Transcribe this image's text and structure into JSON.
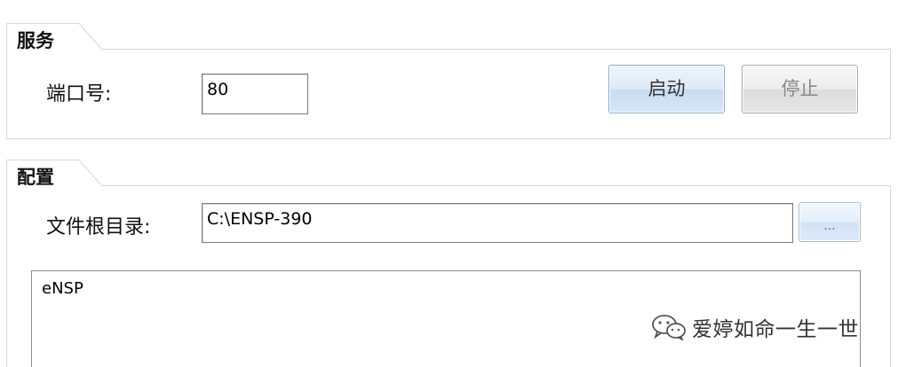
{
  "service": {
    "tab_label": "服务",
    "port_label": "端口号:",
    "port_value": "80",
    "start_label": "启动",
    "stop_label": "停止"
  },
  "config": {
    "tab_label": "配置",
    "root_label": "文件根目录:",
    "root_value": "C:\\ENSP-390",
    "browse_label": "...",
    "log_text": "eNSP"
  },
  "watermark": {
    "icon": "wechat-icon",
    "text": "爱婷如命一生一世"
  }
}
